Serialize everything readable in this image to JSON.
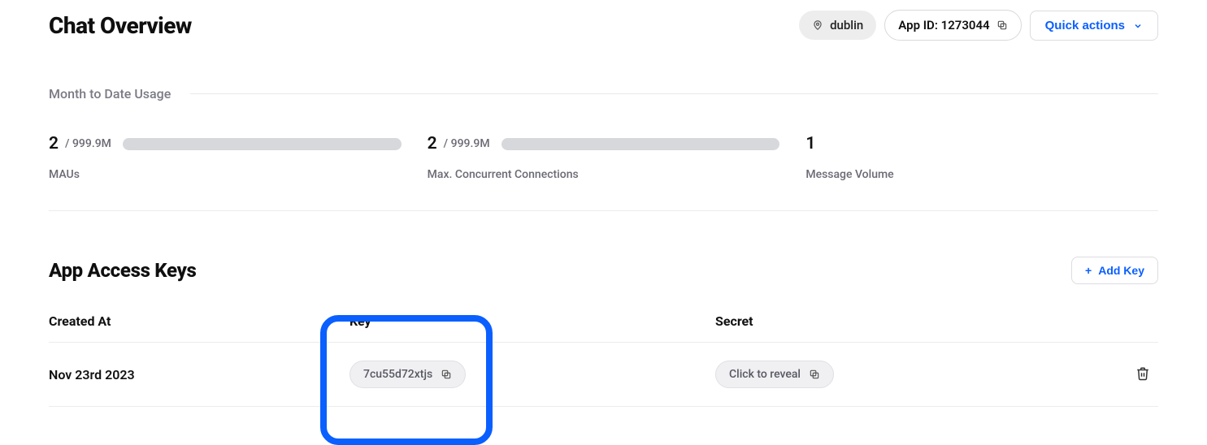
{
  "header": {
    "title": "Chat Overview",
    "region": "dublin",
    "app_id_label": "App ID: 1273044",
    "quick_actions_label": "Quick actions"
  },
  "usage": {
    "section_label": "Month to Date Usage",
    "metrics": {
      "maus": {
        "value": "2",
        "max": "/ 999.9M",
        "label": "MAUs"
      },
      "conns": {
        "value": "2",
        "max": "/ 999.9M",
        "label": "Max. Concurrent Connections"
      },
      "volume": {
        "value": "1",
        "label": "Message Volume"
      }
    }
  },
  "keys": {
    "title": "App Access Keys",
    "add_key_label": "Add Key",
    "columns": {
      "created": "Created At",
      "key": "Key",
      "secret": "Secret"
    },
    "rows": [
      {
        "created": "Nov 23rd 2023",
        "key_value": "7cu55d72xtjs",
        "secret_label": "Click to reveal"
      }
    ]
  }
}
